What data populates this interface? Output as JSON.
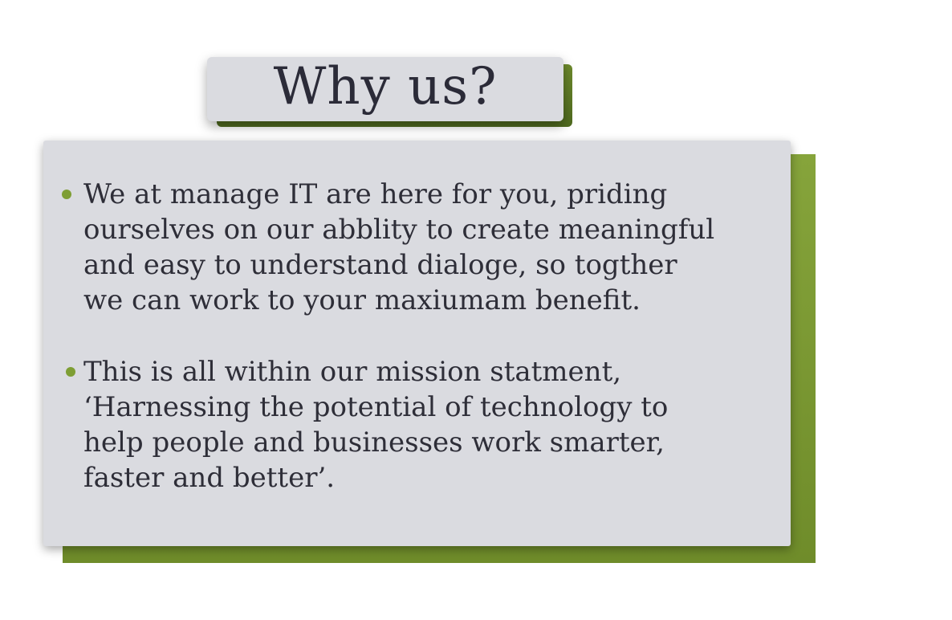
{
  "title": "Why us?",
  "bullets": [
    {
      "text": "We at manage IT are here for you, priding\nourselves on our abblity to create meaningful\nand easy to understand dialoge, so togther\nwe can work to your maxiumam benefit."
    },
    {
      "text": "This is all within our mission statment,\n‘Harnessing the potential of technology to\nhelp people and businesses work smarter,\nfaster and better’."
    }
  ],
  "colors": {
    "panel": "#dadbe0",
    "accent_green": "#7e9e34",
    "text": "#2e2e38"
  }
}
